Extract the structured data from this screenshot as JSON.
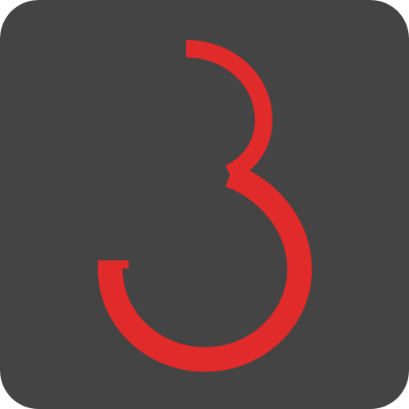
{
  "icon": {
    "name": "logo-three-icon",
    "colors": {
      "tile_background": "#444444",
      "glyph": "#E12A2A"
    }
  }
}
